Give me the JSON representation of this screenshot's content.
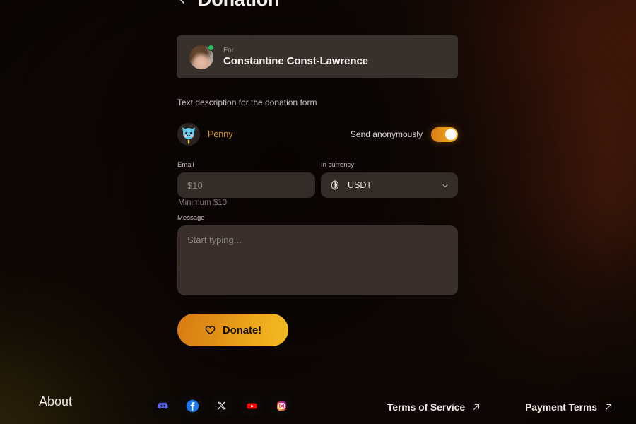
{
  "page": {
    "title": "Donation",
    "back_icon": "chevron-left-icon"
  },
  "recipient": {
    "for_label": "For",
    "name": "Constantine Const-Lawrence",
    "avatar": "user-photo-avatar",
    "status": "online"
  },
  "form": {
    "description": "Text description for the donation form",
    "sender": {
      "name": "Penny",
      "avatar": "cat-avatar"
    },
    "anonymous": {
      "label": "Send anonymously",
      "enabled": true
    },
    "amount": {
      "label": "Email",
      "placeholder": "$10",
      "value": "",
      "helper": "Minimum $10"
    },
    "currency": {
      "label": "In currency",
      "selected": "USDT",
      "icon": "usdt-coin-icon",
      "chevron": "chevron-down-icon"
    },
    "message": {
      "label": "Message",
      "placeholder": "Start typing...",
      "value": ""
    },
    "submit": {
      "label": "Donate!",
      "icon": "heart-icon"
    }
  },
  "footer": {
    "about_label": "About",
    "socials": [
      {
        "name": "discord",
        "color": "#5865F2"
      },
      {
        "name": "facebook",
        "color": "#1877F2"
      },
      {
        "name": "x-twitter",
        "color": "#FFFFFF"
      },
      {
        "name": "youtube",
        "color": "#FF0000"
      },
      {
        "name": "instagram",
        "color": "#E1306C"
      }
    ],
    "links": [
      {
        "label": "Terms of Service",
        "icon": "arrow-up-right-icon"
      },
      {
        "label": "Payment Terms",
        "icon": "arrow-up-right-icon"
      }
    ]
  },
  "theme": {
    "accent_start": "#d97a14",
    "accent_end": "#f3bc22",
    "sender_name_color": "#d79a27",
    "card_bg": "#37302c",
    "input_bg": "#332b27",
    "online_color": "#22c55e"
  }
}
